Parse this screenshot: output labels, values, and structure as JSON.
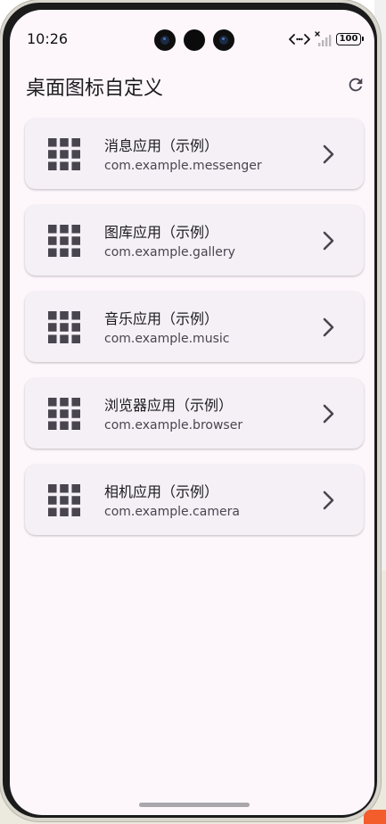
{
  "status_bar": {
    "time": "10:26",
    "battery": "100",
    "icons": [
      "network-activity-icon",
      "no-signal-icon",
      "battery-icon"
    ]
  },
  "app_bar": {
    "title": "桌面图标自定义",
    "action_icon": "refresh-icon"
  },
  "apps": [
    {
      "name": "消息应用（示例）",
      "package": "com.example.messenger",
      "icon": "app-grid-icon"
    },
    {
      "name": "图库应用（示例）",
      "package": "com.example.gallery",
      "icon": "app-grid-icon"
    },
    {
      "name": "音乐应用（示例）",
      "package": "com.example.music",
      "icon": "app-grid-icon"
    },
    {
      "name": "浏览器应用（示例）",
      "package": "com.example.browser",
      "icon": "app-grid-icon"
    },
    {
      "name": "相机应用（示例）",
      "package": "com.example.camera",
      "icon": "app-grid-icon"
    }
  ],
  "colors": {
    "background": "#fdf7fc",
    "card": "#f5f0f6",
    "icon": "#49454f",
    "title": "#1c1b1f"
  }
}
